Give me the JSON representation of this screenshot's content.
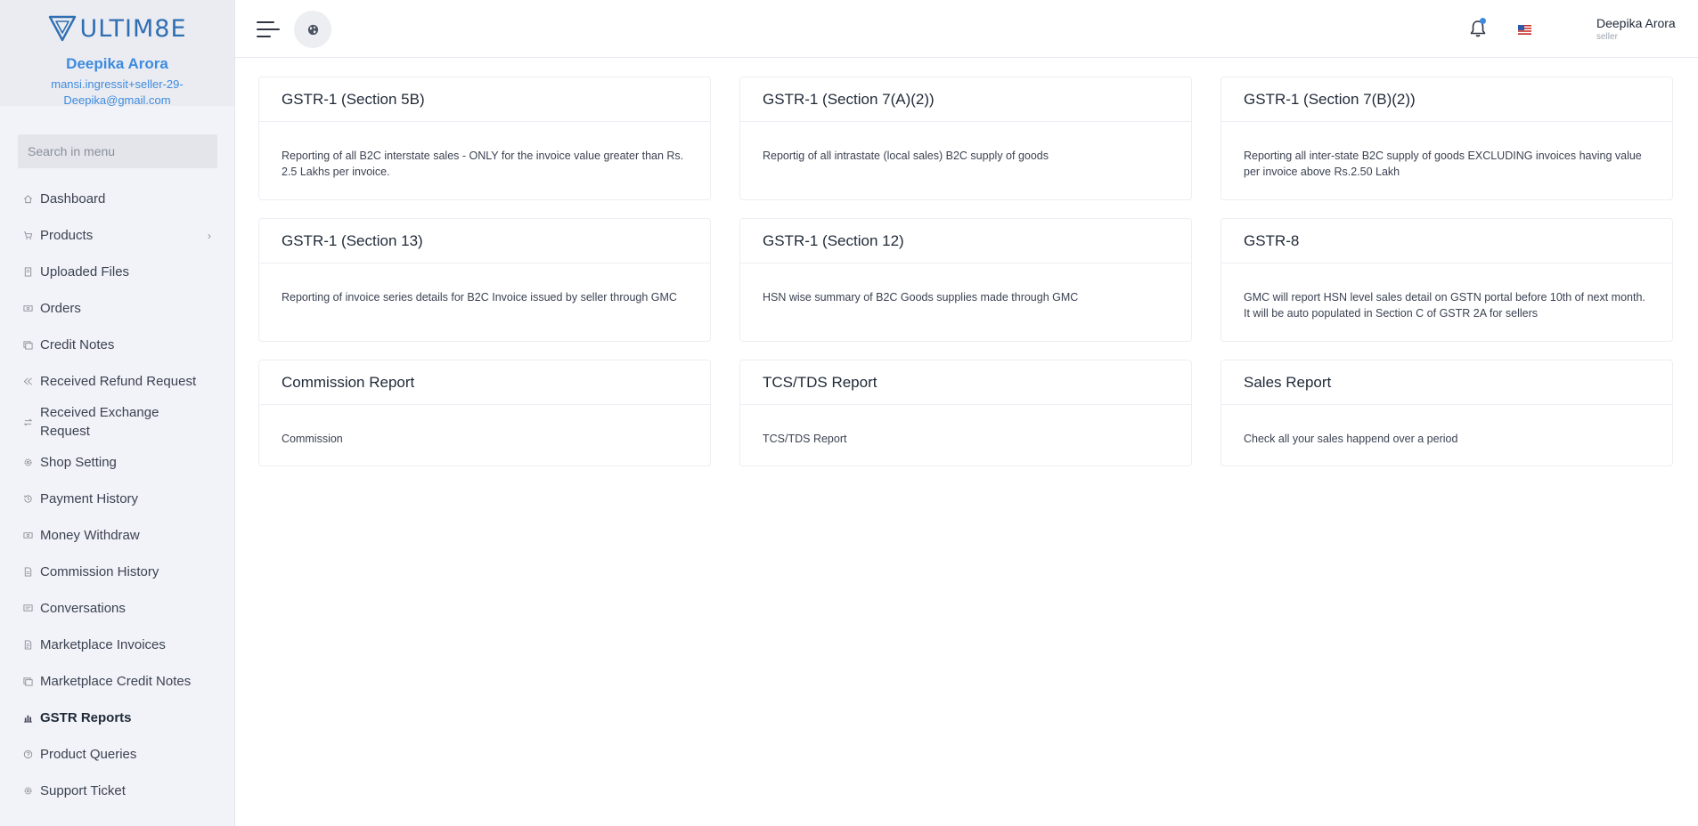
{
  "brand": {
    "logo_text": "ULTIM8E"
  },
  "user": {
    "name": "Deepika Arora",
    "email": "mansi.ingressit+seller-29-Deepika@gmail.com"
  },
  "search": {
    "placeholder": "Search in menu"
  },
  "menu": [
    {
      "label": "Dashboard",
      "icon": "home-icon"
    },
    {
      "label": "Products",
      "icon": "cart-icon",
      "has_submenu": true
    },
    {
      "label": "Uploaded Files",
      "icon": "file-icon"
    },
    {
      "label": "Orders",
      "icon": "money-icon"
    },
    {
      "label": "Credit Notes",
      "icon": "notes-icon"
    },
    {
      "label": "Received Refund Request",
      "icon": "rewind-icon"
    },
    {
      "label": "Received Exchange Request",
      "icon": "exchange-icon"
    },
    {
      "label": "Shop Setting",
      "icon": "gear-icon"
    },
    {
      "label": "Payment History",
      "icon": "history-icon"
    },
    {
      "label": "Money Withdraw",
      "icon": "money-icon"
    },
    {
      "label": "Commission History",
      "icon": "document-icon"
    },
    {
      "label": "Conversations",
      "icon": "chat-icon"
    },
    {
      "label": "Marketplace Invoices",
      "icon": "invoice-icon"
    },
    {
      "label": "Marketplace Credit Notes",
      "icon": "notes-icon"
    },
    {
      "label": "GSTR Reports",
      "icon": "bar-chart-icon",
      "active": true
    },
    {
      "label": "Product Queries",
      "icon": "question-icon"
    },
    {
      "label": "Support Ticket",
      "icon": "support-icon"
    }
  ],
  "header": {
    "profile_name": "Deepika Arora",
    "profile_role": "seller",
    "notification_dot_color": "#3d8be0"
  },
  "cards": [
    {
      "title": "GSTR-1 (Section 5B)",
      "description": "Reporting of all B2C interstate sales - ONLY for the invoice value greater than Rs. 2.5 Lakhs per invoice."
    },
    {
      "title": "GSTR-1 (Section 7(A)(2))",
      "description": "Reportig of all intrastate (local sales) B2C supply of goods"
    },
    {
      "title": "GSTR-1 (Section 7(B)(2))",
      "description": "Reporting all inter-state B2C supply of goods EXCLUDING invoices having value per invoice above Rs.2.50 Lakh"
    },
    {
      "title": "GSTR-1 (Section 13)",
      "description": "Reporting of invoice series details for B2C Invoice issued by seller through GMC"
    },
    {
      "title": "GSTR-1 (Section 12)",
      "description": "HSN wise summary of B2C Goods supplies made through GMC"
    },
    {
      "title": "GSTR-8",
      "description": "GMC will report HSN level sales detail on GSTN portal before 10th of next month. It will be auto populated in Section C of GSTR 2A for sellers"
    },
    {
      "title": "Commission Report",
      "description": "Commission"
    },
    {
      "title": "TCS/TDS Report",
      "description": "TCS/TDS Report"
    },
    {
      "title": "Sales Report",
      "description": "Check all your sales happend over a period"
    }
  ],
  "colors": {
    "accent": "#3d8be0",
    "logo": "#2f6fb3",
    "sidebar_bg": "#f2f3f8"
  }
}
